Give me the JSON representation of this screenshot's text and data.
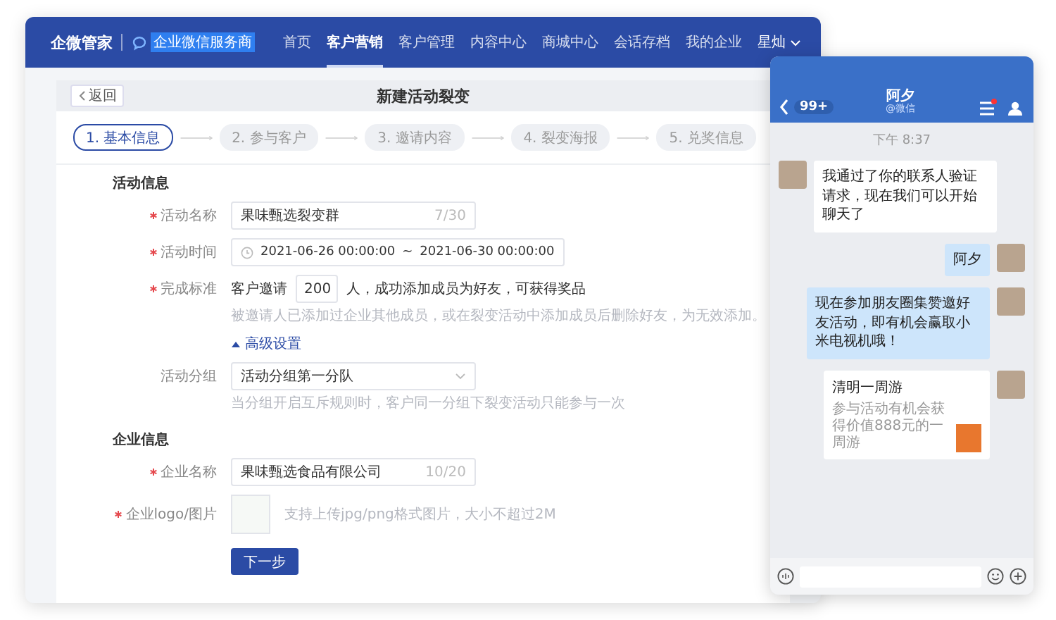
{
  "app": {
    "logo": "企微管家",
    "partner_badge": "企业微信服务商",
    "user": "星灿",
    "nav": [
      {
        "label": "首页",
        "selected": false
      },
      {
        "label": "客户营销",
        "selected": true
      },
      {
        "label": "客户管理",
        "selected": false
      },
      {
        "label": "内容中心",
        "selected": false
      },
      {
        "label": "商城中心",
        "selected": false
      },
      {
        "label": "会话存档",
        "selected": false
      },
      {
        "label": "我的企业",
        "selected": false
      }
    ]
  },
  "page": {
    "back": "返回",
    "title": "新建活动裂变"
  },
  "steps": [
    {
      "label": "1. 基本信息",
      "selected": true
    },
    {
      "label": "2. 参与客户",
      "selected": false
    },
    {
      "label": "3. 邀请内容",
      "selected": false
    },
    {
      "label": "4. 裂变海报",
      "selected": false
    },
    {
      "label": "5. 兑奖信息",
      "selected": false
    }
  ],
  "sections": [
    {
      "title": "活动信息",
      "fields": [
        {
          "kind": "text",
          "label": "活动名称",
          "required": true,
          "value": "果味甄选裂变群",
          "counter": "7/30"
        },
        {
          "kind": "daterange",
          "label": "活动时间",
          "required": true,
          "start": "2021-06-26 00:00:00",
          "separator": "~",
          "end": "2021-06-30 00:00:00"
        },
        {
          "kind": "criteria",
          "label": "完成标准",
          "required": true,
          "prefix": "客户邀请",
          "value": "200",
          "suffix": "人，成功添加成员为好友，可获得奖品",
          "hint": "被邀请人已添加过企业其他成员，或在裂变活动中添加成员后删除好友，为无效添加。"
        },
        {
          "kind": "toggle",
          "label": "高级设置",
          "expanded": true
        },
        {
          "kind": "select",
          "label": "活动分组",
          "required": false,
          "value": "活动分组第一分队",
          "hint": "当分组开启互斥规则时，客户同一分组下裂变活动只能参与一次"
        }
      ]
    },
    {
      "title": "企业信息",
      "fields": [
        {
          "kind": "text",
          "label": "企业名称",
          "required": true,
          "value": "果味甄选食品有限公司",
          "counter": "10/20"
        },
        {
          "kind": "upload",
          "label": "企业logo/图片",
          "required": true,
          "hint": "支持上传jpg/png格式图片，大小不超过2M"
        }
      ]
    }
  ],
  "next_button": "下一步",
  "chat": {
    "badge": "99+",
    "name": "阿夕",
    "subtitle": "@微信",
    "unread_dot": true,
    "time": "下午 8:37",
    "messages": [
      {
        "kind": "text",
        "outgoing": false,
        "text": "我通过了你的联系人验证请求，现在我们可以开始聊天了"
      },
      {
        "kind": "text",
        "outgoing": true,
        "text": "阿夕"
      },
      {
        "kind": "text",
        "outgoing": true,
        "text": "现在参加朋友圈集赞邀好友活动，即有机会赢取小米电视机哦！"
      },
      {
        "kind": "card",
        "outgoing": true,
        "title": "清明一周游",
        "text": "参与活动有机会获得价值888元的一周游"
      }
    ]
  }
}
